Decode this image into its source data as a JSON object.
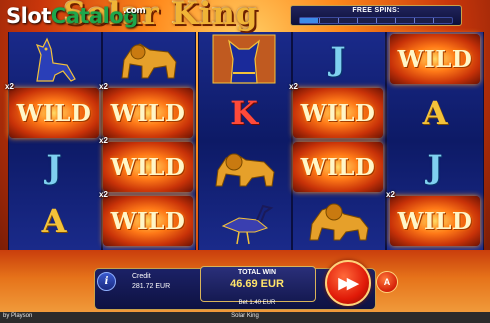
{
  "watermark": {
    "part1": "Slot",
    "part2": "Catalog",
    "part3": ".com"
  },
  "logo": {
    "text": "Solar King"
  },
  "free_spins": {
    "label": "FREE SPINS:",
    "progress": 0.12
  },
  "symbols": {
    "wild": "WILD",
    "multiplier": "x2",
    "J": "J",
    "A": "A",
    "K": "K"
  },
  "bottom": {
    "info_icon": "i",
    "credit_label": "Credit",
    "credit_value": "281.72 EUR",
    "total_win_label": "TOTAL WIN",
    "total_win_value": "46.69 EUR",
    "bet_label": "Bet 1.40 EUR",
    "spin_icon": "fast-forward-icon",
    "autoplay_icon": "A"
  },
  "footer": {
    "brand": "by Playson",
    "title": "Solar King"
  }
}
